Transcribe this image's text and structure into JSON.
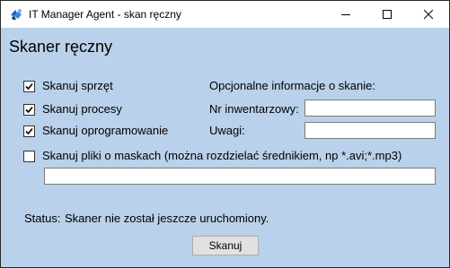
{
  "window": {
    "title": "IT Manager Agent - skan ręczny"
  },
  "header": {
    "title": "Skaner ręczny"
  },
  "options": {
    "scan_hardware": {
      "label": "Skanuj sprzęt",
      "checked": true
    },
    "scan_processes": {
      "label": "Skanuj procesy",
      "checked": true
    },
    "scan_software": {
      "label": "Skanuj oprogramowanie",
      "checked": true
    },
    "scan_files": {
      "label": "Skanuj pliki o maskach (można rozdzielać średnikiem, np *.avi;*.mp3)",
      "checked": false,
      "value": ""
    }
  },
  "optional_info": {
    "heading": "Opcjonalne informacje o skanie:",
    "inventory_label": "Nr inwentarzowy:",
    "inventory_value": "",
    "notes_label": "Uwagi:",
    "notes_value": ""
  },
  "status": {
    "label": "Status:",
    "text": "Skaner nie został jeszcze uruchomiony."
  },
  "actions": {
    "scan_button": "Skanuj"
  },
  "colors": {
    "window_background": "#b9d1ea",
    "titlebar": "#ffffff"
  }
}
